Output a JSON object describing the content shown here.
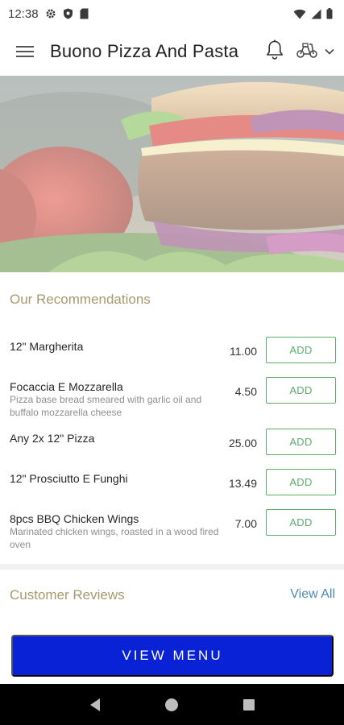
{
  "status_bar": {
    "time": "12:38",
    "icons": [
      "gear-icon",
      "shield-icon",
      "sim-card-icon",
      "wifi-icon",
      "signal-icon",
      "battery-icon"
    ]
  },
  "app_bar": {
    "title": "Buono Pizza And Pasta",
    "icons": [
      "hamburger-menu-icon",
      "bell-icon",
      "scooter-icon",
      "chevron-down-icon"
    ]
  },
  "recommendations": {
    "title": "Our Recommendations",
    "add_label": "ADD",
    "items": [
      {
        "name": "12\" Margherita",
        "description": "",
        "price": "11.00"
      },
      {
        "name": "Focaccia E Mozzarella",
        "description": "Pizza base bread smeared with garlic oil and buffalo mozzarella cheese",
        "price": "4.50"
      },
      {
        "name": "Any 2x 12\" Pizza",
        "description": "",
        "price": "25.00"
      },
      {
        "name": "12\" Prosciutto E Funghi",
        "description": "",
        "price": "13.49"
      },
      {
        "name": "8pcs BBQ Chicken Wings",
        "description": "Marinated chicken wings, roasted in a wood fired oven",
        "price": "7.00"
      }
    ]
  },
  "reviews": {
    "title": "Customer Reviews",
    "view_all": "View All"
  },
  "cta": {
    "label": "VIEW MENU"
  },
  "nav_bar": {
    "icons": [
      "back-triangle-icon",
      "home-circle-icon",
      "recents-square-icon"
    ]
  },
  "colors": {
    "accent_gold": "#a6996d",
    "add_green": "#5aad6b",
    "link_blue": "#4b8bb2",
    "cta_blue": "#0a22d6"
  }
}
